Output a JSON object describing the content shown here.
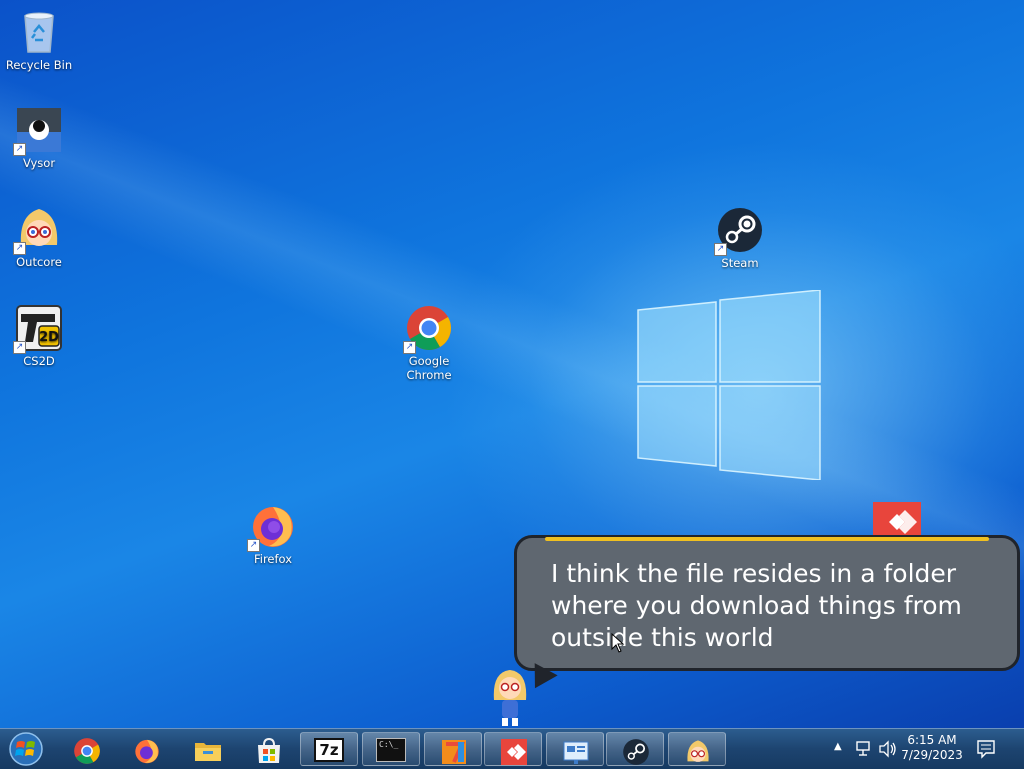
{
  "desktop": {
    "icons": [
      {
        "label": "Recycle Bin",
        "icon": "recycle-bin-icon"
      },
      {
        "label": "Vysor",
        "icon": "vysor-icon"
      },
      {
        "label": "Outcore",
        "icon": "outcore-icon"
      },
      {
        "label": "CS2D",
        "icon": "cs2d-icon"
      },
      {
        "label": "Google Chrome",
        "icon": "chrome-icon"
      },
      {
        "label": "Firefox",
        "icon": "firefox-icon"
      },
      {
        "label": "Steam",
        "icon": "steam-icon"
      }
    ]
  },
  "bubble": {
    "text": "I think the file resides in a folder where you download things from outside this world"
  },
  "taskbar": {
    "pinned": [
      "start-icon",
      "chrome-icon",
      "firefox-icon",
      "file-explorer-icon",
      "store-icon",
      "7zip-icon",
      "cmd-icon",
      "app-icon",
      "anydesk-icon",
      "presentation-icon",
      "steam-icon",
      "outcore-icon"
    ],
    "sevenzip_label": "7z",
    "cmd_label": "C:\\_"
  },
  "tray": {
    "time": "6:15 AM",
    "date": "7/29/2023"
  },
  "colors": {
    "desktop_blue": "#0f74dd",
    "bubble_gray": "#5f6770",
    "taskbar": "#1d4470",
    "anydesk_red": "#e8453c"
  }
}
